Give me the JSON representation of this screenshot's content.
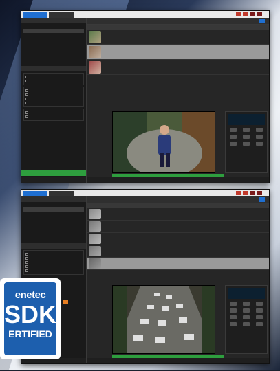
{
  "badge": {
    "brand": "enetec",
    "sdk": "SDK",
    "certified": "ERTIFIED"
  },
  "colors": {
    "accent_blue": "#1f6fd1",
    "accent_green": "#2e9e3e",
    "badge_blue": "#1d5fae"
  }
}
